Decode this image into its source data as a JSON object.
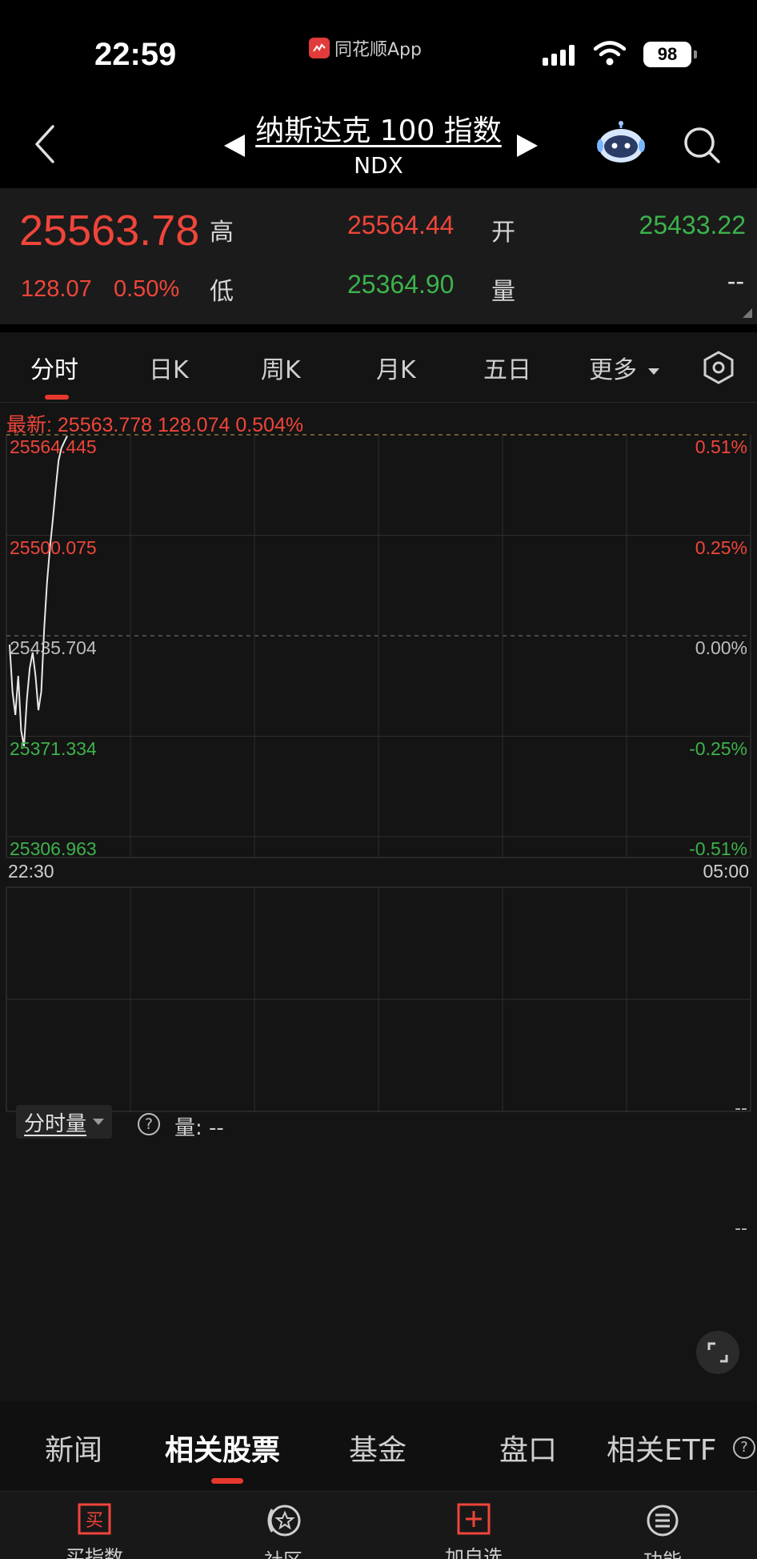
{
  "status_bar": {
    "time": "22:59",
    "app_name": "同花顺App",
    "battery": "98"
  },
  "nav": {
    "title": "纳斯达克 100 指数",
    "code": "NDX"
  },
  "quote": {
    "price": "25563.78",
    "change": "128.07",
    "change_pct": "0.50%",
    "high_label": "高",
    "high": "25564.44",
    "low_label": "低",
    "low": "25364.90",
    "open_label": "开",
    "open": "25433.22",
    "volume_label": "量",
    "volume": "--",
    "up_color": "#f0453a",
    "down_color": "#3db24b"
  },
  "tabs": [
    {
      "label": "分时",
      "active": true
    },
    {
      "label": "日K"
    },
    {
      "label": "周K"
    },
    {
      "label": "月K"
    },
    {
      "label": "五日"
    },
    {
      "label": "更多"
    }
  ],
  "chart_data": {
    "type": "line",
    "latest": "最新: 25563.778  128.074  0.504%",
    "y_left_ticks": [
      "25564.445",
      "25500.075",
      "25435.704",
      "25371.334",
      "25306.963"
    ],
    "y_right_ticks": [
      "0.51%",
      "0.25%",
      "0.00%",
      "-0.25%",
      "-0.51%"
    ],
    "ylim": [
      25306.963,
      25564.445
    ],
    "prev_close": 25435.704,
    "x_start": "22:30",
    "x_end": "05:00",
    "series": [
      {
        "values": [
          25430,
          25400,
          25385,
          25410,
          25375,
          25365,
          25395,
          25415,
          25425,
          25410,
          25388,
          25400,
          25440,
          25470,
          25492,
          25510,
          25530,
          25548,
          25556,
          25560,
          25563.778
        ]
      }
    ]
  },
  "volume_panel": {
    "selector_label": "分时量",
    "volume_text": "量: --",
    "right_top": "--",
    "right_mid": "--"
  },
  "bottom_tabs": [
    {
      "label": "新闻"
    },
    {
      "label": "相关股票",
      "active": true
    },
    {
      "label": "基金"
    },
    {
      "label": "盘口"
    },
    {
      "label": "相关ETF"
    }
  ],
  "toolbar": [
    {
      "label": "买指数",
      "icon": "buy-icon",
      "glyph": "买"
    },
    {
      "label": "社区",
      "icon": "community-icon"
    },
    {
      "label": "加自选",
      "icon": "add-watchlist-icon",
      "glyph": "+"
    },
    {
      "label": "功能",
      "icon": "menu-icon"
    }
  ]
}
